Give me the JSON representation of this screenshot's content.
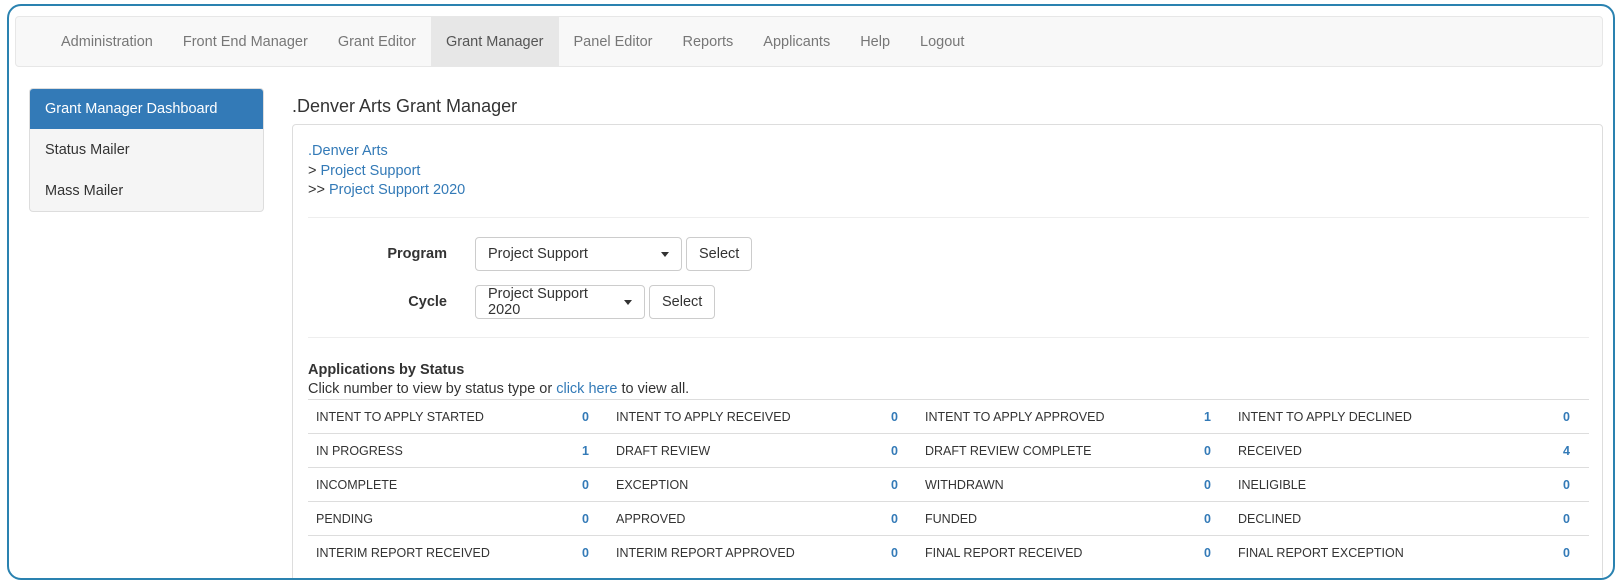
{
  "navbar": {
    "items": [
      {
        "label": "Administration"
      },
      {
        "label": "Front End Manager"
      },
      {
        "label": "Grant Editor"
      },
      {
        "label": "Grant Manager"
      },
      {
        "label": "Panel Editor"
      },
      {
        "label": "Reports"
      },
      {
        "label": "Applicants"
      },
      {
        "label": "Help"
      },
      {
        "label": "Logout"
      }
    ],
    "active": "Grant Manager"
  },
  "sidebar": {
    "items": [
      {
        "label": "Grant Manager Dashboard"
      },
      {
        "label": "Status Mailer"
      },
      {
        "label": "Mass Mailer"
      }
    ]
  },
  "main": {
    "title": ".Denver Arts Grant Manager",
    "breadcrumbs": {
      "level1": ".Denver Arts",
      "level2_prefix": ">",
      "level2": "Project Support",
      "level3_prefix": ">>",
      "level3": "Project Support 2020"
    },
    "program": {
      "label": "Program",
      "value": "Project Support",
      "button": "Select"
    },
    "cycle": {
      "label": "Cycle",
      "value": "Project Support 2020",
      "button": "Select"
    },
    "applications": {
      "title": "Applications by Status",
      "help_prefix": "Click number to view by status type or",
      "help_link": "click here",
      "help_suffix": "to view all.",
      "rows": [
        [
          {
            "label": "INTENT TO APPLY STARTED",
            "count": "0"
          },
          {
            "label": "INTENT TO APPLY RECEIVED",
            "count": "0"
          },
          {
            "label": "INTENT TO APPLY APPROVED",
            "count": "1"
          },
          {
            "label": "INTENT TO APPLY DECLINED",
            "count": "0"
          }
        ],
        [
          {
            "label": "IN PROGRESS",
            "count": "1"
          },
          {
            "label": "DRAFT REVIEW",
            "count": "0"
          },
          {
            "label": "DRAFT REVIEW COMPLETE",
            "count": "0"
          },
          {
            "label": "RECEIVED",
            "count": "4"
          }
        ],
        [
          {
            "label": "INCOMPLETE",
            "count": "0"
          },
          {
            "label": "EXCEPTION",
            "count": "0"
          },
          {
            "label": "WITHDRAWN",
            "count": "0"
          },
          {
            "label": "INELIGIBLE",
            "count": "0"
          }
        ],
        [
          {
            "label": "PENDING",
            "count": "0"
          },
          {
            "label": "APPROVED",
            "count": "0"
          },
          {
            "label": "FUNDED",
            "count": "0"
          },
          {
            "label": "DECLINED",
            "count": "0"
          }
        ],
        [
          {
            "label": "INTERIM REPORT RECEIVED",
            "count": "0"
          },
          {
            "label": "INTERIM REPORT APPROVED",
            "count": "0"
          },
          {
            "label": "FINAL REPORT RECEIVED",
            "count": "0"
          },
          {
            "label": "FINAL REPORT EXCEPTION",
            "count": "0"
          }
        ]
      ]
    }
  },
  "colors": {
    "frame_border": "#2a82b0",
    "link": "#337ab7",
    "active_sidebar_bg": "#337ab7",
    "navbar_bg": "#f8f8f8",
    "navbar_active_bg": "#e7e7e7"
  }
}
